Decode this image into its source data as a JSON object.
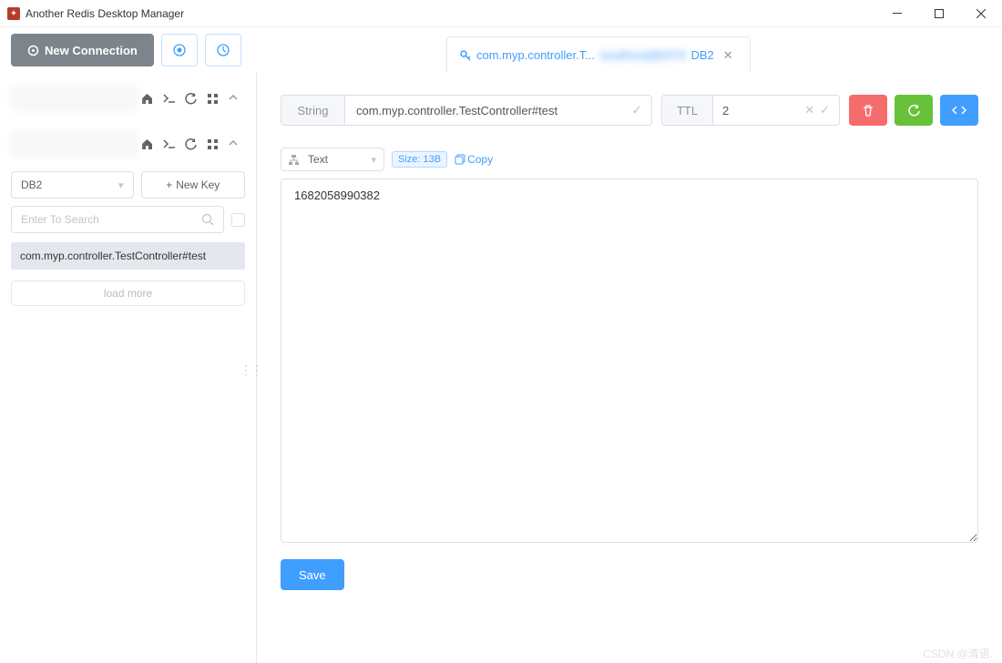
{
  "window": {
    "title": "Another Redis Desktop Manager"
  },
  "toolbar": {
    "new_connection": "New Connection"
  },
  "tab": {
    "key_label": "com.myp.controller.T...",
    "blurred_text": "localhost@6379",
    "db_label": "DB2"
  },
  "sidebar": {
    "db_select": "DB2",
    "new_key": "New Key",
    "search_placeholder": "Enter To Search",
    "keys": [
      "com.myp.controller.TestController#test"
    ],
    "load_more": "load more"
  },
  "main": {
    "type": "String",
    "key": "com.myp.controller.TestController#test",
    "ttl_label": "TTL",
    "ttl_value": "2",
    "format": "Text",
    "size_badge": "Size: 13B",
    "copy": "Copy",
    "value": "1682058990382",
    "save": "Save"
  },
  "watermark": "CSDN @清语."
}
